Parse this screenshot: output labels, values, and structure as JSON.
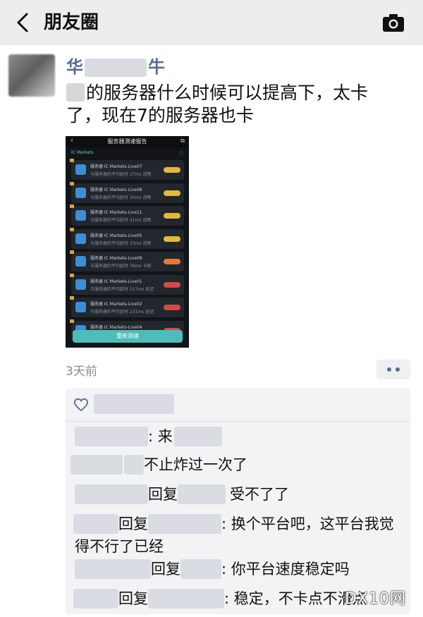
{
  "header": {
    "title": "朋友圈",
    "back_icon": "chevron-left-icon",
    "camera_icon": "camera-icon"
  },
  "post": {
    "user_first": "华",
    "user_last": "牛",
    "text": "的服务器什么时候可以提高下，太卡了，现在7的服务器也卡",
    "time": "3天前",
    "colors": {
      "name": "#576b95",
      "background_bar": "#ededed",
      "accent": "#4dbdb7"
    }
  },
  "screenshot": {
    "title": "服务器测速报告",
    "subtitle": "IC Markets",
    "button": "重新测速",
    "servers": [
      {
        "name": "服务器  IC Markets-Live07",
        "detail": "与服务器的平均延时 27ms 流畅",
        "badge": "#e3b93b"
      },
      {
        "name": "服务器  IC Markets-Live06",
        "detail": "与服务器的平均延时 30ms 流畅",
        "badge": "#e3b93b"
      },
      {
        "name": "服务器  IC Markets-Live11",
        "detail": "与服务器的平均延时 31ms 流畅",
        "badge": "#e3b93b"
      },
      {
        "name": "服务器  IC Markets-Live05",
        "detail": "与服务器的平均延时 33ms 流畅",
        "badge": "#e3b93b"
      },
      {
        "name": "服务器  IC Markets-Live09",
        "detail": "与服务器的平均延时 78ms 卡顿",
        "badge": "#e07a3a"
      },
      {
        "name": "服务器  IC Markets-Live01",
        "detail": "与服务器的平均延时 227ms 延迟",
        "badge": "#d24a4a"
      },
      {
        "name": "服务器  IC Markets-Live02",
        "detail": "与服务器的平均延时 231ms 延迟",
        "badge": "#d24a4a"
      },
      {
        "name": "服务器  IC Markets-Live04",
        "detail": "",
        "badge": "#d24a4a"
      }
    ]
  },
  "comments": [
    {
      "pre": "",
      "text": ": 来"
    },
    {
      "pre": "",
      "text": "不止炸过一次了"
    },
    {
      "pre": "回复",
      "text": "受不了了"
    },
    {
      "pre": "回复",
      "text": ": 换个平台吧，这平台我觉得不行了已经"
    },
    {
      "pre": "回复",
      "text": ": 你平台速度稳定吗"
    },
    {
      "pre": "回复",
      "text": ": 稳定，不卡点不滑点"
    }
  ],
  "watermark": "DX10网"
}
